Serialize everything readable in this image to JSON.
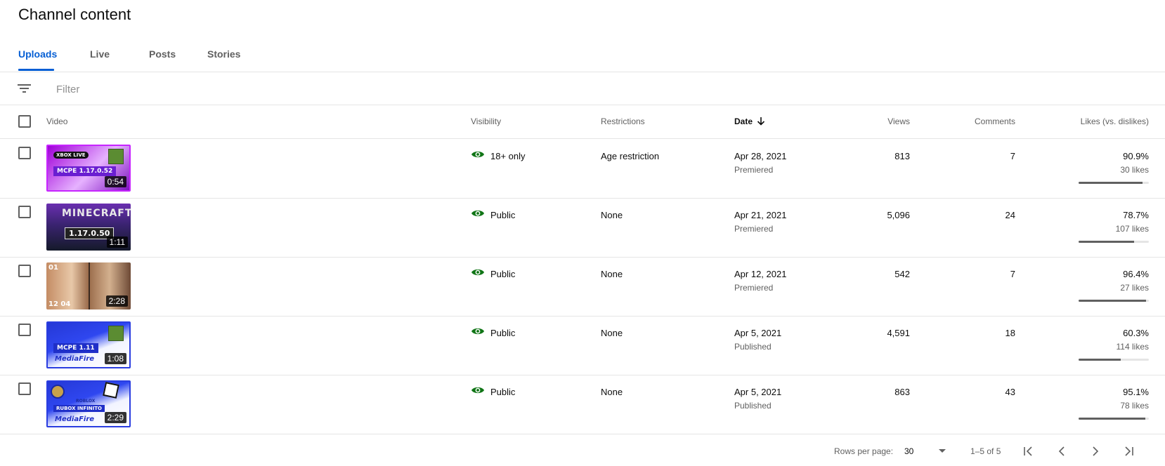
{
  "page": {
    "title": "Channel content"
  },
  "tabs": [
    {
      "label": "Uploads",
      "active": true
    },
    {
      "label": "Live",
      "active": false
    },
    {
      "label": "Posts",
      "active": false
    },
    {
      "label": "Stories",
      "active": false
    }
  ],
  "filter": {
    "placeholder": "Filter",
    "icon": "filter-icon"
  },
  "table": {
    "headers": {
      "video": "Video",
      "visibility": "Visibility",
      "restrictions": "Restrictions",
      "date": "Date",
      "views": "Views",
      "comments": "Comments",
      "likes": "Likes (vs. dislikes)"
    },
    "sort": {
      "column": "date",
      "direction": "descending",
      "icon": "arrow-down-icon"
    },
    "rows": [
      {
        "duration": "0:54",
        "thumb_text": [
          "XBOX LIVE",
          "MCPE 1.17.0.52"
        ],
        "visibility": "18+ only",
        "restrictions": "Age restriction",
        "date": "Apr 28, 2021",
        "date_status": "Premiered",
        "views": "813",
        "comments": "7",
        "likes_pct": "90.9%",
        "likes_count": "30 likes",
        "likes_ratio": 0.909
      },
      {
        "duration": "1:11",
        "thumb_text": [
          "MINECRAFT",
          "1.17.0.50"
        ],
        "visibility": "Public",
        "restrictions": "None",
        "date": "Apr 21, 2021",
        "date_status": "Premiered",
        "views": "5,096",
        "comments": "24",
        "likes_pct": "78.7%",
        "likes_count": "107 likes",
        "likes_ratio": 0.787
      },
      {
        "duration": "2:28",
        "thumb_text": [
          "01",
          "12 04"
        ],
        "visibility": "Public",
        "restrictions": "None",
        "date": "Apr 12, 2021",
        "date_status": "Premiered",
        "views": "542",
        "comments": "7",
        "likes_pct": "96.4%",
        "likes_count": "27 likes",
        "likes_ratio": 0.964
      },
      {
        "duration": "1:08",
        "thumb_text": [
          "MCPE 1.11",
          "MediaFire"
        ],
        "visibility": "Public",
        "restrictions": "None",
        "date": "Apr 5, 2021",
        "date_status": "Published",
        "views": "4,591",
        "comments": "18",
        "likes_pct": "60.3%",
        "likes_count": "114 likes",
        "likes_ratio": 0.603
      },
      {
        "duration": "2:29",
        "thumb_text": [
          "ROBLOX",
          "RUBOX INFINITO",
          "MediaFire"
        ],
        "visibility": "Public",
        "restrictions": "None",
        "date": "Apr 5, 2021",
        "date_status": "Published",
        "views": "863",
        "comments": "43",
        "likes_pct": "95.1%",
        "likes_count": "78 likes",
        "likes_ratio": 0.951
      }
    ]
  },
  "pagination": {
    "rows_per_page_label": "Rows per page:",
    "rows_per_page": "30",
    "range": "1–5 of 5"
  },
  "colors": {
    "accent": "#065fd4",
    "visibility_icon": "#107516",
    "text_secondary": "#606060",
    "divider": "#e5e5e5"
  }
}
